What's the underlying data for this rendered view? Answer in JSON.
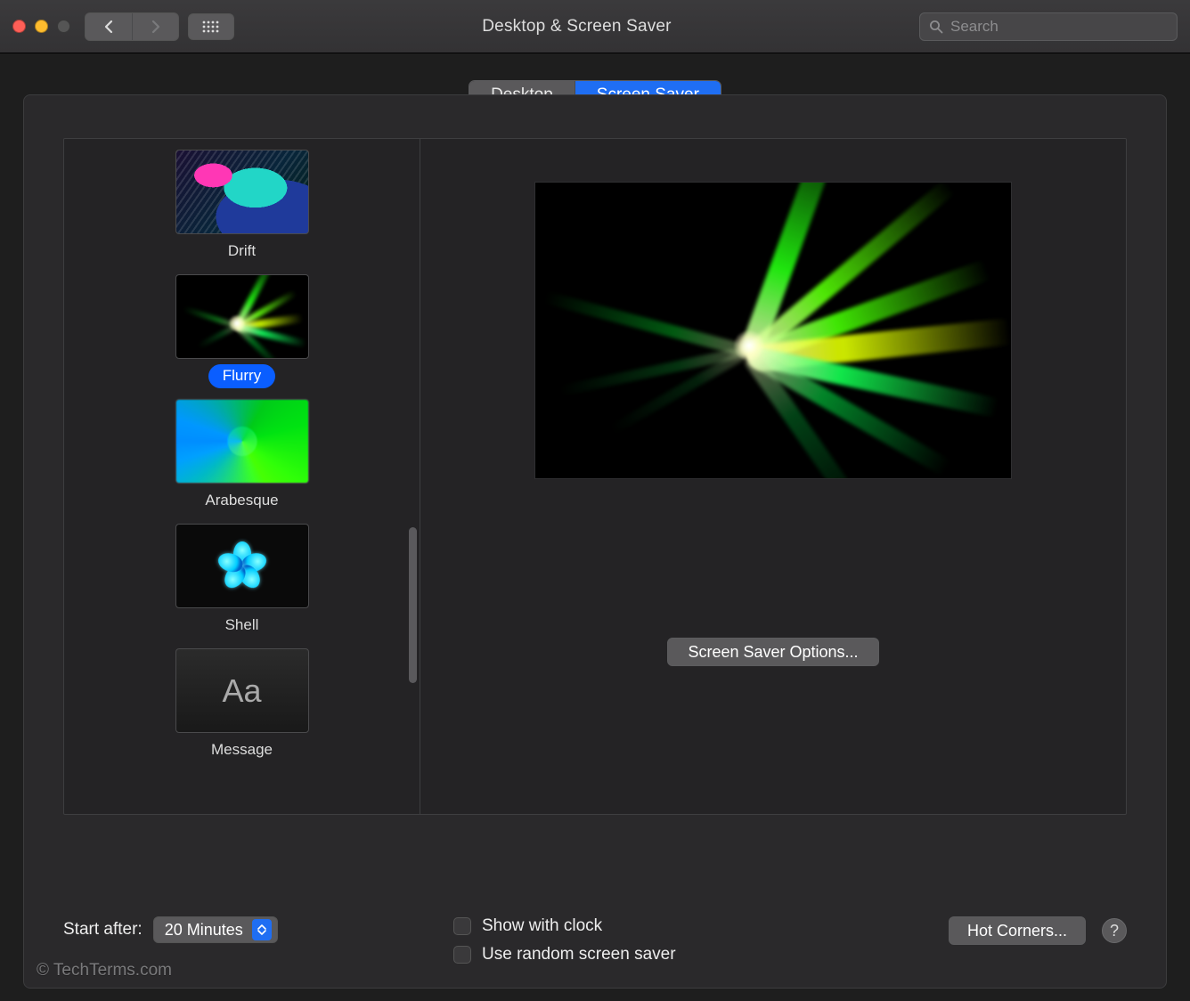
{
  "window": {
    "title": "Desktop & Screen Saver"
  },
  "search": {
    "placeholder": "Search"
  },
  "tabs": {
    "desktop": "Desktop",
    "screensaver": "Screen Saver",
    "active": "screensaver"
  },
  "screensavers": {
    "items": [
      {
        "label": "Drift"
      },
      {
        "label": "Flurry"
      },
      {
        "label": "Arabesque"
      },
      {
        "label": "Shell"
      },
      {
        "label": "Message"
      }
    ],
    "selected_index": 1
  },
  "preview": {
    "options_button": "Screen Saver Options..."
  },
  "footer": {
    "start_after_label": "Start after:",
    "start_after_value": "20 Minutes",
    "show_with_clock": "Show with clock",
    "use_random": "Use random screen saver",
    "hot_corners": "Hot Corners...",
    "help": "?"
  },
  "message_thumb_text": "Aa",
  "watermark": "© TechTerms.com"
}
